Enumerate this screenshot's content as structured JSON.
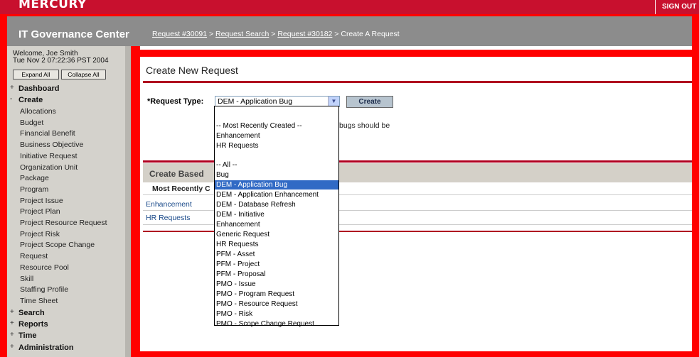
{
  "brand": {
    "logo": "MERCURY",
    "signout": "SIGN OUT"
  },
  "header": {
    "app_title": "IT Governance Center",
    "breadcrumb": [
      {
        "label": "Request #30091",
        "link": true
      },
      {
        "label": " > ",
        "link": false
      },
      {
        "label": "Request Search",
        "link": true
      },
      {
        "label": " > ",
        "link": false
      },
      {
        "label": "Request #30182",
        "link": true
      },
      {
        "label": " > Create A Request",
        "link": false
      }
    ]
  },
  "sidebar": {
    "welcome": "Welcome, Joe Smith",
    "timestamp": "Tue Nov 2 07:22:36 PST 2004",
    "expand_all": "Expand All",
    "collapse_all": "Collapse All",
    "dashboard": "Dashboard",
    "create": "Create",
    "create_items": [
      "Allocations",
      "Budget",
      "Financial Benefit",
      "Business Objective",
      "Initiative Request",
      "Organization Unit",
      "Package",
      "Program",
      "Project Issue",
      "Project Plan",
      "Project Resource Request",
      "Project Risk",
      "Project Scope Change",
      "Request",
      "Resource Pool",
      "Skill",
      "Staffing Profile",
      "Time Sheet"
    ],
    "search": "Search",
    "reports": "Reports",
    "time": "Time",
    "administration": "Administration",
    "expand_sign": "+",
    "collapse_sign": "-"
  },
  "main": {
    "page_title": "Create New Request",
    "request_type_label": "*Request Type:",
    "request_type_value": "DEM - Application Bug",
    "create_button": "Create",
    "help_text": "bugs should be",
    "based_title": "Create Based",
    "recent_header": "Most Recently C",
    "recent_items": [
      "Enhancement",
      "HR Requests"
    ]
  },
  "dropdown": {
    "options": [
      "-- Most Recently Created --",
      "Enhancement",
      "HR Requests",
      "",
      "-- All --",
      "Bug",
      "DEM - Application Bug",
      "DEM - Application Enhancement",
      "DEM - Database Refresh",
      "DEM - Initiative",
      "Enhancement",
      "Generic Request",
      "HR Requests",
      "PFM - Asset",
      "PFM - Project",
      "PFM - Proposal",
      "PMO - Issue",
      "PMO - Program Request",
      "PMO - Resource Request",
      "PMO - Risk",
      "PMO - Scope Change Request"
    ],
    "selected": "DEM - Application Bug"
  },
  "colors": {
    "brand_red": "#c8102e",
    "highlight_red": "#ff0000",
    "selection_blue": "#316ac5",
    "link_blue": "#1a4a8a"
  }
}
